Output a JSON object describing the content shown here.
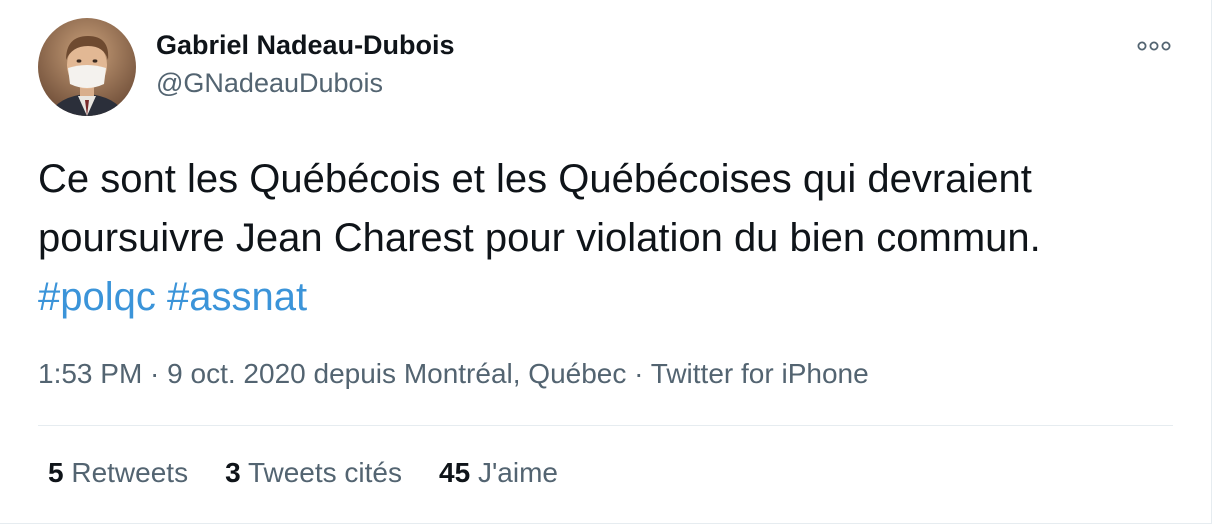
{
  "tweet": {
    "author": {
      "name": "Gabriel Nadeau-Dubois",
      "handle": "@GNadeauDubois"
    },
    "body": {
      "line1": "Ce sont les Québécois et les Québécoises qui devraient",
      "line2": "poursuivre Jean Charest pour violation du bien commun.",
      "hashtags": [
        "#polqc",
        "#assnat"
      ]
    },
    "meta": {
      "time": "1:53 PM",
      "separator": " · ",
      "date": "9 oct. 2020",
      "location_prefix": " depuis ",
      "location": "Montréal, Québec",
      "source": "Twitter for iPhone"
    },
    "stats": {
      "retweets": {
        "count": "5",
        "label": "Retweets"
      },
      "quotes": {
        "count": "3",
        "label": "Tweets cités"
      },
      "likes": {
        "count": "45",
        "label": "J'aime"
      }
    }
  },
  "icons": {
    "more": "more-options-icon"
  },
  "colors": {
    "hashtag": "#3b94d9",
    "text": "#0f1419",
    "secondary": "#536471",
    "divider": "#e6ecf0"
  }
}
